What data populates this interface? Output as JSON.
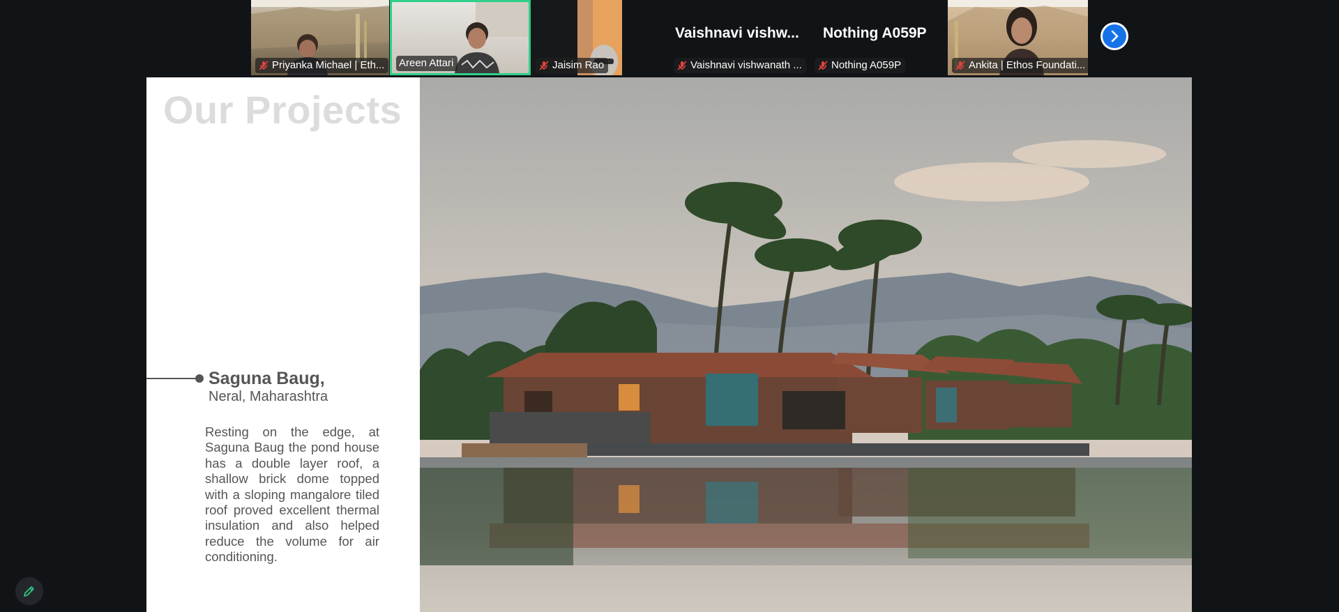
{
  "meeting": {
    "participants": [
      {
        "display_name": "Priyanka Michael | Eth...",
        "muted": true,
        "video": true
      },
      {
        "display_name": "Areen Attari",
        "muted": false,
        "video": true,
        "active_speaker": true
      },
      {
        "display_name": "Jaisim Rao",
        "muted": true,
        "video": true
      },
      {
        "display_name": "Vaishnavi vishwanath ...",
        "big_label": "Vaishnavi  vishw...",
        "muted": true,
        "video": false
      },
      {
        "display_name": "Nothing A059P",
        "big_label": "Nothing A059P",
        "muted": true,
        "video": false
      },
      {
        "display_name": "Ankita | Ethos Foundati...",
        "muted": true,
        "video": true
      }
    ],
    "next_page_icon": "chevron-right-icon",
    "annotate_icon": "pencil-icon",
    "colors": {
      "background": "#111417",
      "active_speaker_border": "#2fd08a",
      "next_button": "#1672e8",
      "mic_off": "#e0443e"
    }
  },
  "slide": {
    "title": "Our Projects",
    "project": {
      "name": "Saguna Baug,",
      "location": "Neral, Maharashtra",
      "description": "Resting on the edge, at Saguna Baug the pond house has a double layer roof, a shallow brick dome topped with a sloping mangalore tiled roof proved excellent thermal insulation and also helped reduce the volume for air conditioning."
    },
    "photo_subject": "pond house with tiled roofs among palm trees and hills, reflected in water"
  }
}
